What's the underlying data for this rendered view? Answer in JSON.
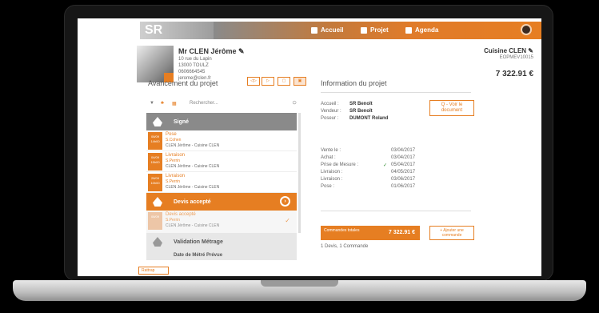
{
  "nav": {
    "logo": "SR",
    "items": [
      {
        "label": "Accueil"
      },
      {
        "label": "Projet"
      },
      {
        "label": "Agenda"
      }
    ]
  },
  "client": {
    "name": "Mr CLEN Jérôme",
    "address1": "10 rue du Lapin",
    "address2": "13000 TOULZ",
    "phone": "0606664545",
    "email": "jerome@clen.fr"
  },
  "project": {
    "title": "Cuisine CLEN",
    "subtitle": "EOPMEV10015",
    "amount": "7 322.91 €"
  },
  "avancement": {
    "title": "Avancement du projet",
    "search_placeholder": "Rechercher...",
    "sections": {
      "signe": "Signé",
      "devis_accepte": "Devis accepté",
      "validation_metrage": "Validation Métrage",
      "next": "Date de Métré Prévue"
    },
    "events": [
      {
        "date": "06/09 14h00",
        "t1": "Pose",
        "t2": "S.Cohen",
        "t3": "CLEN Jérôme - Cuisine CLEN"
      },
      {
        "date": "04/09 15h00",
        "t1": "Livraison",
        "t2": "S.Perrin",
        "t3": "CLEN Jérôme - Cuisine CLEN"
      },
      {
        "date": "28/09 10h00",
        "t1": "Livraison",
        "t2": "S.Perrin",
        "t3": "CLEN Jérôme - Cuisine CLEN"
      }
    ],
    "faded_event": {
      "date": "06/09",
      "t1": "Devis accepté",
      "t2": "S.Perrin",
      "t3": "CLEN Jérôme - Cuisine CLEN"
    },
    "add_label": "Rattrap"
  },
  "info": {
    "title": "Information du projet",
    "rows": [
      {
        "label": "Accueil :",
        "value": "SR Benoît"
      },
      {
        "label": "Vendeur :",
        "value": "SR Benoît"
      },
      {
        "label": "Poseur :",
        "value": "DUMONT Roland"
      }
    ],
    "open_doc_label": "Q - Voir le document",
    "dates": [
      {
        "label": "Vente le :",
        "value": "03/04/2017"
      },
      {
        "label": "Achat :",
        "value": "03/04/2017"
      },
      {
        "label": "Prise de Mesure :",
        "value": "05/04/2017"
      },
      {
        "label": "Livraison :",
        "value": "04/05/2017"
      },
      {
        "label": "Livraison :",
        "value": "03/06/2017"
      },
      {
        "label": "Pose :",
        "value": "01/06/2017"
      }
    ],
    "total_label": "Commandes totales",
    "total_value": "7 322.91 €",
    "add_cmd_label": "+ Ajouter une commande",
    "footer": "1 Devis, 1 Commande"
  },
  "colors": {
    "accent": "#e67e22",
    "grey_header": "#8a8a8a"
  }
}
